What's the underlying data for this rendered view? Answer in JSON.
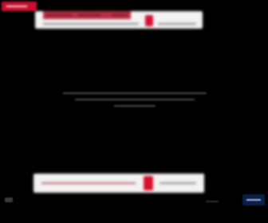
{
  "colors": {
    "background": "#000000",
    "brand_red": "#c8102e",
    "banner_bg": "#f2f2f2",
    "marker_red": "#d7102f",
    "corner_navy": "#0b1e4a"
  },
  "icons": {
    "brand": "brand-logo-icon",
    "corner_left": "mute-icon",
    "corner_right": "publisher-logo-icon"
  }
}
